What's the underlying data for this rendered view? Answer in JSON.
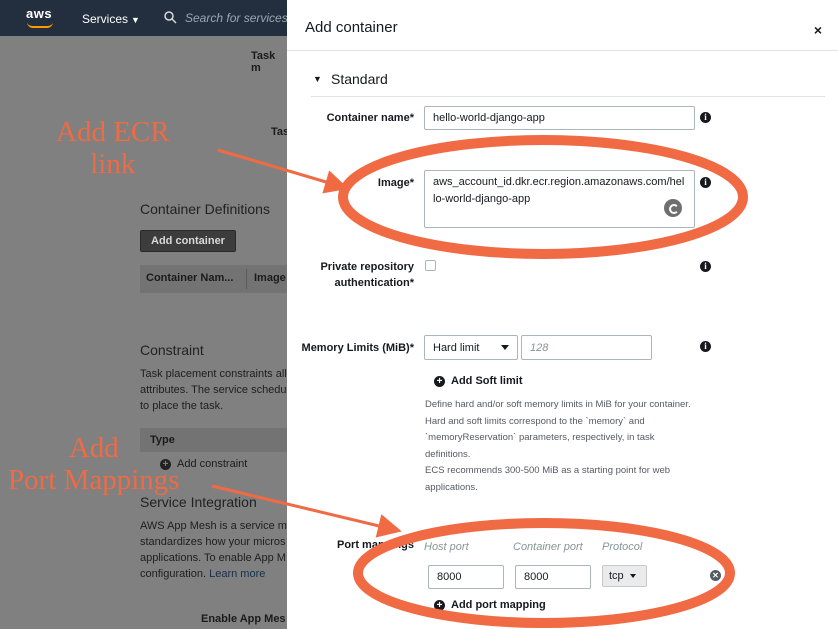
{
  "nav": {
    "logo": "aws",
    "services_label": "Services",
    "search_placeholder": "Search for services, features, marketplace products, and docs"
  },
  "background_page": {
    "task_field_1": "Task m",
    "task_field_2": "Tas",
    "container_definitions_title": "Container Definitions",
    "add_container_button": "Add container",
    "table_col_1": "Container Nam...",
    "table_col_2": "Image",
    "constraint_title": "Constraint",
    "constraint_text": "Task placement constraints all attributes. The service schedu to place the task.",
    "type_header": "Type",
    "add_constraint": "Add constraint",
    "service_integration_title": "Service Integration",
    "service_integration_text": "AWS App Mesh is a service m standardizes how your micros applications. To enable App M configuration.",
    "learn_more": "Learn more",
    "enable_app_mesh": "Enable App Mes"
  },
  "modal": {
    "title": "Add container",
    "close": "×",
    "section_title": "Standard",
    "container_name": {
      "label": "Container name*",
      "value": "hello-world-django-app"
    },
    "image": {
      "label": "Image*",
      "value": "aws_account_id.dkr.ecr.region.amazonaws.com/hello-world-django-app"
    },
    "private_repo_auth": {
      "label": "Private repository authentication*"
    },
    "memory_limits": {
      "label": "Memory Limits (MiB)*",
      "limit_type": "Hard limit",
      "placeholder": "128",
      "add_soft_limit": "Add Soft limit",
      "help_lines": [
        "Define hard and/or soft memory limits in MiB for your container.",
        "Hard and soft limits correspond to the `memory` and",
        "`memoryReservation` parameters, respectively, in task",
        "definitions.",
        "ECS recommends 300-500 MiB as a starting point for web",
        "applications."
      ]
    },
    "port_mappings": {
      "label": "Port mappings",
      "host_port_header": "Host port",
      "container_port_header": "Container port",
      "protocol_header": "Protocol",
      "host_port": "8000",
      "container_port": "8000",
      "protocol": "tcp",
      "add_port_mapping": "Add port mapping"
    }
  },
  "annotations": {
    "ecr_line1": "Add ECR",
    "ecr_line2": "link",
    "port_line1": "Add",
    "port_line2": "Port Mappings",
    "color": "#f06a43"
  }
}
